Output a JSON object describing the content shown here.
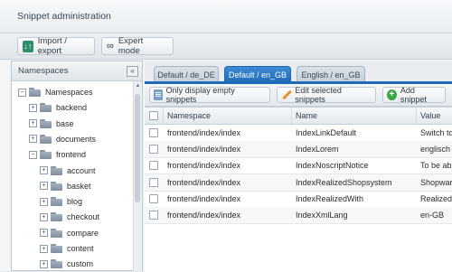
{
  "window": {
    "title": "Snippet administration"
  },
  "toolbar": {
    "import_export": "Import / export",
    "expert_mode": "Expert mode"
  },
  "namespaces": {
    "header": "Namespaces",
    "collapse_glyph": "«",
    "tree": [
      {
        "label": "Namespaces",
        "depth": 0,
        "toggle": "−"
      },
      {
        "label": "backend",
        "depth": 1,
        "toggle": "+"
      },
      {
        "label": "base",
        "depth": 1,
        "toggle": "+"
      },
      {
        "label": "documents",
        "depth": 1,
        "toggle": "+"
      },
      {
        "label": "frontend",
        "depth": 1,
        "toggle": "−"
      },
      {
        "label": "account",
        "depth": 2,
        "toggle": "+"
      },
      {
        "label": "basket",
        "depth": 2,
        "toggle": "+"
      },
      {
        "label": "blog",
        "depth": 2,
        "toggle": "+"
      },
      {
        "label": "checkout",
        "depth": 2,
        "toggle": "+"
      },
      {
        "label": "compare",
        "depth": 2,
        "toggle": "+"
      },
      {
        "label": "content",
        "depth": 2,
        "toggle": "+"
      },
      {
        "label": "custom",
        "depth": 2,
        "toggle": "+"
      }
    ]
  },
  "tabs": [
    {
      "label": "Default / de_DE",
      "active": false
    },
    {
      "label": "Default / en_GB",
      "active": true
    },
    {
      "label": "English / en_GB",
      "active": false
    }
  ],
  "actions": {
    "empty": "Only display empty snippets",
    "edit": "Edit selected snippets",
    "add": "Add snippet"
  },
  "grid": {
    "columns": [
      "Namespace",
      "Name",
      "Value"
    ],
    "rows": [
      [
        "frontend/index/index",
        "IndexLinkDefault",
        "Switch to"
      ],
      [
        "frontend/index/index",
        "IndexLorem",
        "englisch"
      ],
      [
        "frontend/index/index",
        "IndexNoscriptNotice",
        "To be abl"
      ],
      [
        "frontend/index/index",
        "IndexRealizedShopsystem",
        "Shopware"
      ],
      [
        "frontend/index/index",
        "IndexRealizedWith",
        "Realized"
      ],
      [
        "frontend/index/index",
        "IndexXmlLang",
        "en-GB"
      ]
    ]
  },
  "colors": {
    "accent": "#1f6cb8",
    "add_green": "#3aa64a",
    "edit_orange": "#e8922a"
  },
  "icons": [
    "import-export-icon",
    "glasses-icon",
    "collapse-icon",
    "folder-icon",
    "document-icon",
    "pencil-icon",
    "add-icon"
  ]
}
